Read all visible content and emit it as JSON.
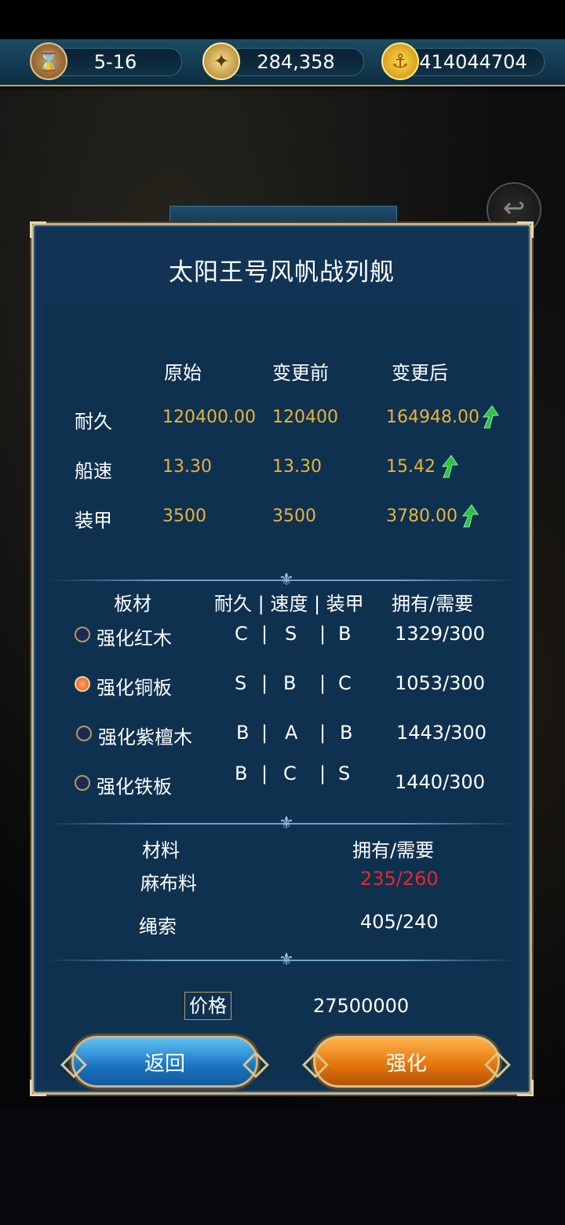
{
  "resources": [
    {
      "icon": "hourglass-icon",
      "value": "5-16"
    },
    {
      "icon": "compass-icon",
      "value": "284,358"
    },
    {
      "icon": "anchor-coin-icon",
      "value": "414044704"
    }
  ],
  "dialog": {
    "title": "太阳王号风帆战列舰",
    "stats": {
      "headers": [
        "原始",
        "变更前",
        "变更后"
      ],
      "rows": [
        {
          "label": "耐久",
          "original": "120400.00",
          "before": "120400",
          "after": "164948.00",
          "increased": true
        },
        {
          "label": "船速",
          "original": "13.30",
          "before": "13.30",
          "after": "15.42",
          "increased": true
        },
        {
          "label": "装甲",
          "original": "3500",
          "before": "3500",
          "after": "3780.00",
          "increased": true
        }
      ]
    },
    "boards": {
      "headers": {
        "name": "板材",
        "grades": "耐久 | 速度 | 装甲",
        "owned": "拥有/需要"
      },
      "separator": "|",
      "items": [
        {
          "name": "强化红木",
          "durability": "C",
          "speed": "S",
          "armor": "B",
          "owned": "1329/300",
          "selected": false
        },
        {
          "name": "强化铜板",
          "durability": "S",
          "speed": "B",
          "armor": "C",
          "owned": "1053/300",
          "selected": true
        },
        {
          "name": "强化紫檀木",
          "durability": "B",
          "speed": "A",
          "armor": "B",
          "owned": "1443/300",
          "selected": false
        },
        {
          "name": "强化铁板",
          "durability": "B",
          "speed": "C",
          "armor": "S",
          "owned": "1440/300",
          "selected": false
        }
      ]
    },
    "materials": {
      "headers": {
        "name": "材料",
        "owned": "拥有/需要"
      },
      "items": [
        {
          "name": "麻布料",
          "owned": "235/260",
          "insufficient": true
        },
        {
          "name": "绳索",
          "owned": "405/240",
          "insufficient": false
        }
      ]
    },
    "price": {
      "label": "价格",
      "value": "27500000"
    },
    "buttons": {
      "back": "返回",
      "enhance": "强化"
    }
  },
  "colors": {
    "value_gold": "#e7b43a",
    "insufficient_red": "#e02a2a",
    "up_arrow_green": "#2fbf4a",
    "panel_blue": "#113454",
    "border_gold": "#c8b28a"
  }
}
